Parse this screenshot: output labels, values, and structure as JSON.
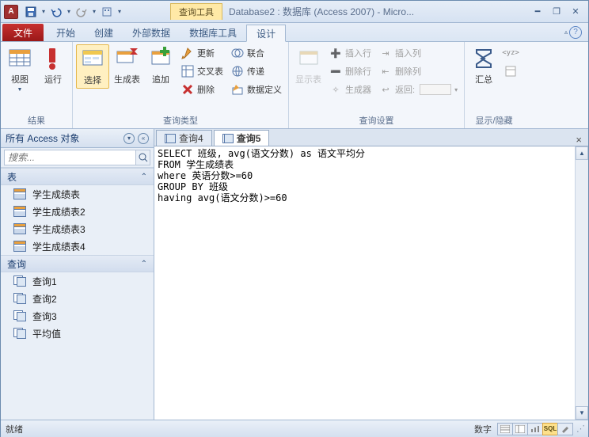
{
  "app_letter": "A",
  "title": "Database2 : 数据库 (Access 2007) - Micro...",
  "contextual_tab": "查询工具",
  "tabs": {
    "file": "文件",
    "home": "开始",
    "create": "创建",
    "external": "外部数据",
    "dbtools": "数据库工具",
    "design": "设计"
  },
  "ribbon": {
    "results": {
      "label": "结果",
      "view": "视图",
      "run": "运行"
    },
    "querytype": {
      "label": "查询类型",
      "select": "选择",
      "maketable": "生成表",
      "append": "追加",
      "update": "更新",
      "crosstab": "交叉表",
      "delete": "删除",
      "union": "联合",
      "passthrough": "传递",
      "datadef": "数据定义"
    },
    "setup": {
      "label": "查询设置",
      "showtable": "显示表",
      "insrow": "插入行",
      "delrow": "删除行",
      "builder": "生成器",
      "inscol": "插入列",
      "delcol": "删除列",
      "return": "返回:"
    },
    "showhide": {
      "label": "显示/隐藏",
      "totals": "汇总"
    }
  },
  "nav": {
    "header": "所有 Access 对象",
    "search_placeholder": "搜索...",
    "group_tables": "表",
    "group_queries": "查询",
    "tables": [
      "学生成绩表",
      "学生成绩表2",
      "学生成绩表3",
      "学生成绩表4"
    ],
    "queries": [
      "查询1",
      "查询2",
      "查询3",
      "平均值"
    ]
  },
  "doctabs": {
    "q4": "查询4",
    "q5": "查询5"
  },
  "sql": "SELECT 班级, avg(语文分数) as 语文平均分\nFROM 学生成绩表\nwhere 英语分数>=60\nGROUP BY 班级\nhaving avg(语文分数)>=60",
  "status": {
    "ready": "就绪",
    "numlock": "数字"
  }
}
